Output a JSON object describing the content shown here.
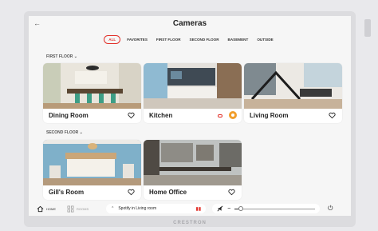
{
  "header": {
    "title": "Cameras",
    "back_icon": "arrow-left-icon"
  },
  "filters": [
    {
      "label": "ALL",
      "active": true
    },
    {
      "label": "FAVORITES",
      "active": false
    },
    {
      "label": "FIRST FLOOR",
      "active": false
    },
    {
      "label": "SECOND FLOOR",
      "active": false
    },
    {
      "label": "BASEMENT",
      "active": false
    },
    {
      "label": "OUTSIDE",
      "active": false
    }
  ],
  "sections": {
    "first_floor": "FIRST FLOOR",
    "second_floor": "SECOND FLOOR"
  },
  "cameras": [
    {
      "name": "Dining Room",
      "favorite": false
    },
    {
      "name": "Kitchen",
      "favorite": false,
      "recording": true,
      "alert": true
    },
    {
      "name": "Living Room",
      "favorite": false
    },
    {
      "name": "Gill's Room",
      "favorite": false
    },
    {
      "name": "Home Office",
      "favorite": false
    }
  ],
  "bottom_bar": {
    "home_label": "HOME",
    "rooms_label": "ROOMS",
    "music_label": "Spotify in Living room",
    "volume_level": 0.05
  },
  "brand": "CRESTRON",
  "colors": {
    "accent": "#e2322b",
    "alert": "#f19e2c",
    "background": "#f6f6f6"
  }
}
